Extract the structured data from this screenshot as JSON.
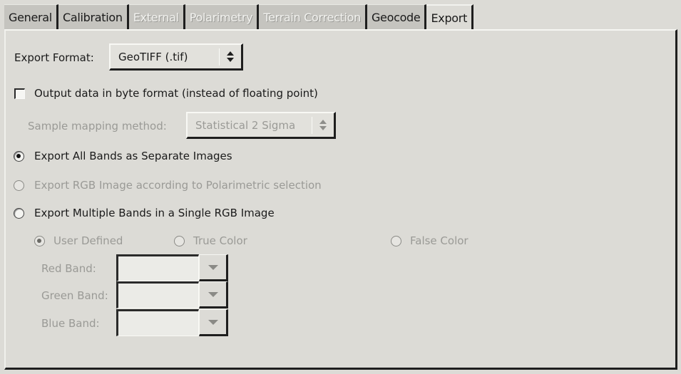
{
  "tabs": [
    {
      "label": "General",
      "state": "enabled"
    },
    {
      "label": "Calibration",
      "state": "enabled"
    },
    {
      "label": "External",
      "state": "disabled"
    },
    {
      "label": "Polarimetry",
      "state": "disabled"
    },
    {
      "label": "Terrain Correction",
      "state": "disabled"
    },
    {
      "label": "Geocode",
      "state": "enabled"
    },
    {
      "label": "Export",
      "state": "active"
    }
  ],
  "export_format": {
    "label": "Export Format:",
    "value": "GeoTIFF (.tif)"
  },
  "byte_format": {
    "label": "Output data in byte format (instead of floating point)",
    "checked": false
  },
  "sample_mapping": {
    "label": "Sample mapping method:",
    "value": "Statistical 2 Sigma",
    "enabled": false
  },
  "export_options": [
    {
      "label": "Export All Bands as Separate Images",
      "selected": true,
      "enabled": true
    },
    {
      "label": "Export RGB Image according to Polarimetric selection",
      "selected": false,
      "enabled": false
    },
    {
      "label": "Export Multiple Bands in a Single RGB Image",
      "selected": false,
      "enabled": true
    }
  ],
  "rgb_modes": [
    {
      "label": "User Defined",
      "selected": true,
      "enabled": false
    },
    {
      "label": "True Color",
      "selected": false,
      "enabled": false
    },
    {
      "label": "False Color",
      "selected": false,
      "enabled": false
    }
  ],
  "bands": [
    {
      "label": "Red Band:",
      "value": ""
    },
    {
      "label": "Green Band:",
      "value": ""
    },
    {
      "label": "Blue Band:",
      "value": ""
    }
  ]
}
